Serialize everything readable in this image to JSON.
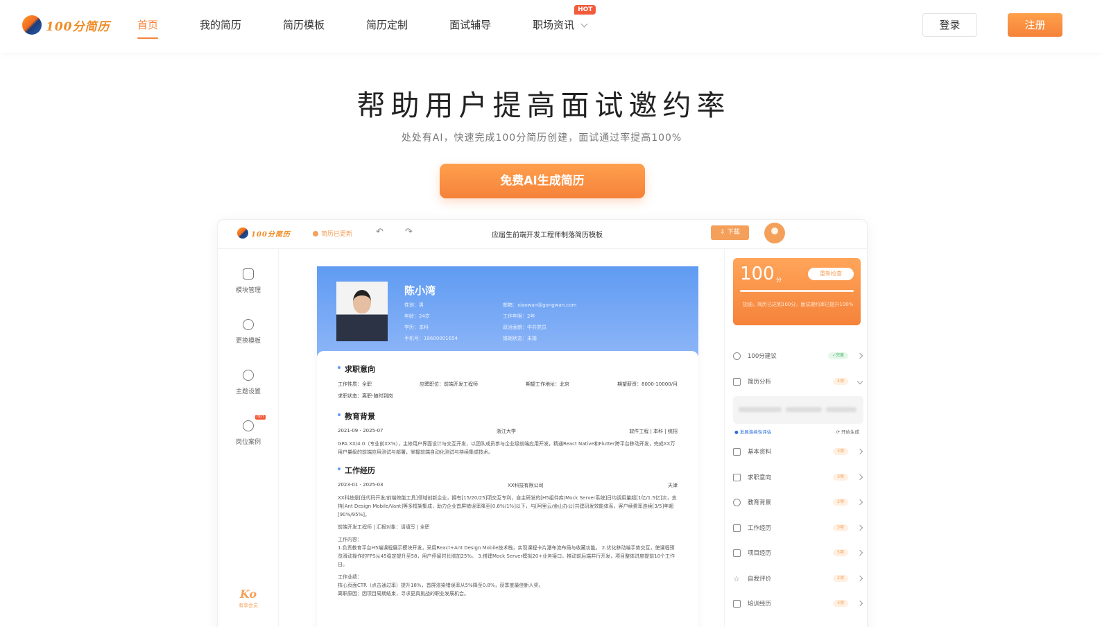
{
  "header": {
    "logo_text": "100分简历",
    "nav": [
      {
        "label": "首页",
        "active": true
      },
      {
        "label": "我的简历",
        "active": false
      },
      {
        "label": "简历模板",
        "active": false
      },
      {
        "label": "简历定制",
        "active": false
      },
      {
        "label": "面试辅导",
        "active": false
      },
      {
        "label": "职场资讯",
        "active": false,
        "badge": "HOT",
        "has_dropdown": true
      }
    ],
    "login_label": "登录",
    "register_label": "注册"
  },
  "hero": {
    "title": "帮助用户提高面试邀约率",
    "subtitle": "处处有AI，快速完成100分简历创建，面试通过率提高100%",
    "cta_label": "免费AI生成简历"
  },
  "preview": {
    "logo_text": "100分简历",
    "status_text": "简历已更新",
    "doc_title": "应届生前端开发工程师制落简历模板",
    "download_label": "下载",
    "sidebar": [
      {
        "label": "模块管理",
        "icon": "grid-icon"
      },
      {
        "label": "更换模板",
        "icon": "swap-icon"
      },
      {
        "label": "主题设置",
        "icon": "palette-icon"
      },
      {
        "label": "岗位案例",
        "icon": "case-icon",
        "badge": "HOT"
      }
    ],
    "sidebar_bottom": {
      "mark": "Ko",
      "text": "有享会员"
    },
    "resume": {
      "name": "陈小湾",
      "info_left": [
        "性别：男",
        "年龄：24岁",
        "学历：本科",
        "手机号：18600001654"
      ],
      "info_right": [
        "邮箱：xiaowan@gongwan.com",
        "工作年限：2年",
        "政治面貌：中共党员",
        "婚姻状态：未婚"
      ],
      "sections": {
        "intent": {
          "title": "求职意向",
          "fields": [
            "工作性质：全职",
            "应聘职位：前端开发工程师",
            "期望工作地址：北京",
            "期望薪资：8000-10000/月"
          ],
          "status": "求职状态：离职-随时到岗"
        },
        "education": {
          "title": "教育背景",
          "date": "2021-09 - 2025-07",
          "school": "浙江大学",
          "major": "软件工程 | 本科 | 统招",
          "desc": "GPA XX/4.0（专业前XX%），主修用户界面设计与交互开发，以团队成员参与企业级前端应用开发，精通React Native和Flutter跨平台移动开发，完成XX万用户量级的前端应用测试与部署，掌握前端自动化测试与持续集成技术。"
        },
        "work": {
          "title": "工作经历",
          "date": "2023-01 - 2025-03",
          "company": "XX科技有限公司",
          "city": "天津",
          "desc": "XX科技是[低代码开发/前端效能工具]领域创新企业，拥有[15/20/25]项交互专利，自主研发的[H5组件库/Mock Server系统]日均调用量超[1亿/1.5亿]次，支持[Ant Design Mobile/Vant]等多框架集成，助力企业首屏错误率降至[0.8%/1%]以下，与[阿里云/金山办公]共建研发效能体系，客户续费率连续[3/5]年超[90%/95%]。",
          "role": "前端开发工程师 | 汇报对象：请填写 | 全职",
          "content_title": "工作内容：",
          "content": "1.负责教育平台H5端课程展示模块开发，采用React+Ant Design Mobile技术栈，实现课程卡片瀑布流布局与收藏功能。 2.优化移动端手势交互，使课程预览滑动操作的FPS从45稳定提升至58，用户停留时长增加25%。 3.搭建Mock Server模拟20+业务接口，推动前后端并行开发，项目整体进度提前10个工作日。",
          "result_title": "工作业绩：",
          "result": "核心页面CTR（点击通过率）提升18%，首屏渲染错误率从5%降至0.8%，获季度最佳新人奖。",
          "reason": "离职原因：因项目周期结束，寻求更具挑战的职业发展机会。"
        }
      }
    },
    "score": {
      "value": "100",
      "unit": "分",
      "button_label": "重新检查",
      "desc": "加油，简历已达到100分，面试邀约率已提升100%"
    },
    "right_items": [
      {
        "label": "100分建议",
        "badge": "✓完美",
        "ok": true
      },
      {
        "label": "简历分析",
        "badge": "4项",
        "expanded": true
      },
      {
        "label": "基本资料",
        "badge": "3项"
      },
      {
        "label": "求职意向",
        "badge": "3项"
      },
      {
        "label": "教育背景",
        "badge": "2项"
      },
      {
        "label": "工作经历",
        "badge": "3项"
      },
      {
        "label": "项目经历",
        "badge": "5项"
      },
      {
        "label": "自我评价",
        "badge": "2项"
      },
      {
        "label": "培训经历",
        "badge": "3项"
      }
    ],
    "mini_row": {
      "left": "发展连续性评估",
      "right": "开始生成"
    },
    "colors": {
      "accent": "#f5823a",
      "resume_header": "#5f9bf2",
      "hot": "#f25a3a"
    }
  }
}
